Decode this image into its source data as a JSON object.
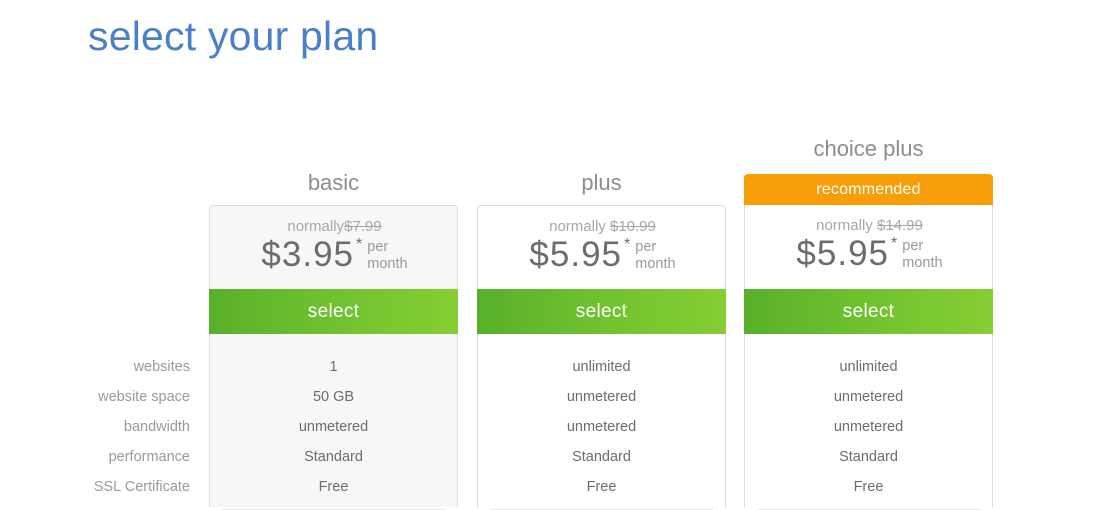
{
  "page": {
    "title": "select your plan",
    "title_color": "#4a80ca",
    "background": "#ffffff"
  },
  "colors": {
    "accent_green_dark": "#58b02a",
    "accent_green_light": "#86ce33",
    "recommended_orange": "#f79e09",
    "card_border": "#dcdcdc",
    "card_fill_highlight": "#f7f7f7",
    "label_gray": "#9a9a9a",
    "value_gray": "#6c6c6c"
  },
  "features": {
    "labels": [
      "websites",
      "website space",
      "bandwidth",
      "performance",
      "SSL Certificate"
    ]
  },
  "plans": [
    {
      "id": "basic",
      "name": "basic",
      "badge": "",
      "normally_label": "normally",
      "normally_price": "$7.99",
      "price": "$3.95",
      "star": "*",
      "period_line1": "per",
      "period_line2": "month",
      "cta": "select",
      "values": [
        "1",
        "50 GB",
        "unmetered",
        "Standard",
        "Free"
      ]
    },
    {
      "id": "plus",
      "name": "plus",
      "badge": "",
      "normally_label": "normally",
      "normally_price": "$10.99",
      "price": "$5.95",
      "star": "*",
      "period_line1": "per",
      "period_line2": "month",
      "cta": "select",
      "values": [
        "unlimited",
        "unmetered",
        "unmetered",
        "Standard",
        "Free"
      ]
    },
    {
      "id": "choice-plus",
      "name": "choice plus",
      "badge": "recommended",
      "normally_label": "normally",
      "normally_price": "$14.99",
      "price": "$5.95",
      "star": "*",
      "period_line1": "per",
      "period_line2": "month",
      "cta": "select",
      "values": [
        "unlimited",
        "unmetered",
        "unmetered",
        "Standard",
        "Free"
      ]
    }
  ]
}
